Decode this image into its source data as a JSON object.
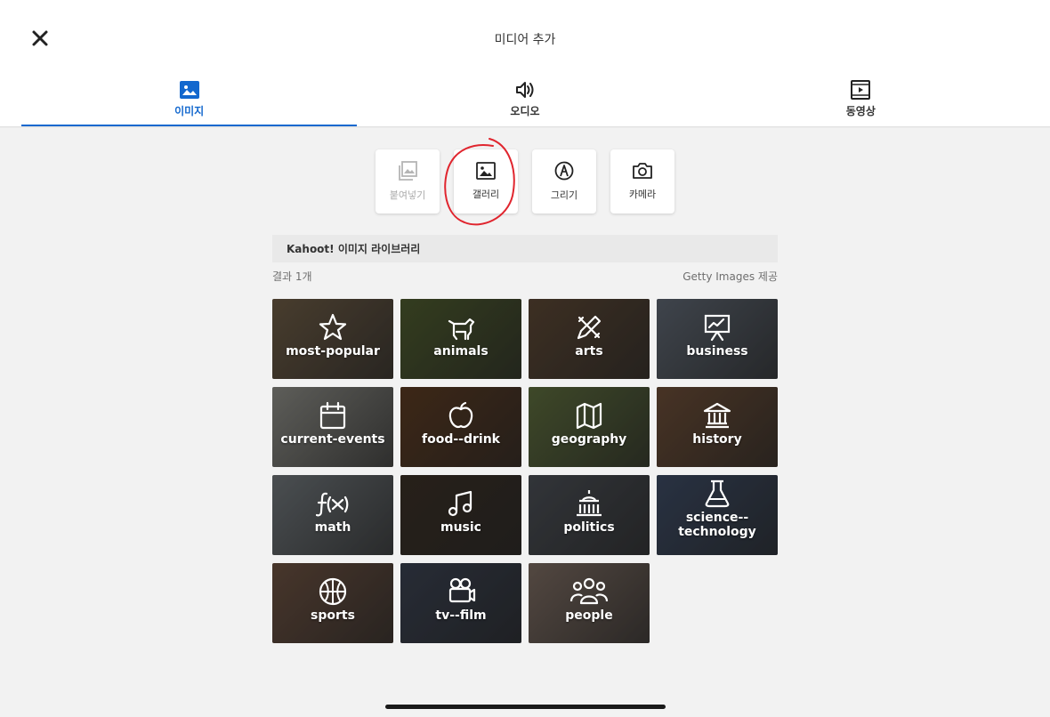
{
  "header": {
    "title": "미디어 추가",
    "close_icon": "close-icon"
  },
  "tabs": [
    {
      "label": "이미지",
      "icon": "image-icon",
      "active": true
    },
    {
      "label": "오디오",
      "icon": "speaker-icon",
      "active": false
    },
    {
      "label": "동영상",
      "icon": "video-icon",
      "active": false
    }
  ],
  "sources": [
    {
      "label": "붙여넣기",
      "icon": "paste-icon",
      "disabled": true
    },
    {
      "label": "갤러리",
      "icon": "gallery-icon",
      "disabled": false
    },
    {
      "label": "그리기",
      "icon": "draw-icon",
      "disabled": false
    },
    {
      "label": "카메라",
      "icon": "camera-icon",
      "disabled": false
    }
  ],
  "library": {
    "title": "Kahoot! 이미지 라이브러리",
    "results": "결과 1개",
    "provider": "Getty Images 제공"
  },
  "categories": [
    {
      "label": "most-popular",
      "icon": "star-icon",
      "color": "#6b5a44"
    },
    {
      "label": "animals",
      "icon": "animal-icon",
      "color": "#4d5a2e"
    },
    {
      "label": "arts",
      "icon": "pencil-ruler-icon",
      "color": "#5a4634"
    },
    {
      "label": "business",
      "icon": "presentation-icon",
      "color": "#5d6570"
    },
    {
      "label": "current-events",
      "icon": "calendar-icon",
      "color": "#8a8a84"
    },
    {
      "label": "food--drink",
      "icon": "apple-icon",
      "color": "#5a3a22"
    },
    {
      "label": "geography",
      "icon": "map-icon",
      "color": "#5c6b3c"
    },
    {
      "label": "history",
      "icon": "museum-icon",
      "color": "#6a4c36"
    },
    {
      "label": "math",
      "icon": "function-icon",
      "color": "#6e7478"
    },
    {
      "label": "music",
      "icon": "music-note-icon",
      "color": "#3a3026"
    },
    {
      "label": "politics",
      "icon": "capitol-icon",
      "color": "#4a4e54"
    },
    {
      "label": "science--\ntechnology",
      "icon": "flask-icon",
      "color": "#3c4a62"
    },
    {
      "label": "sports",
      "icon": "basketball-icon",
      "color": "#6a5040"
    },
    {
      "label": "tv--film",
      "icon": "film-camera-icon",
      "color": "#3a4150"
    },
    {
      "label": "people",
      "icon": "group-icon",
      "color": "#7a6a60"
    }
  ],
  "colors": {
    "accent": "#1368ce",
    "background": "#f2f2f2",
    "annotation": "#e0252e"
  }
}
